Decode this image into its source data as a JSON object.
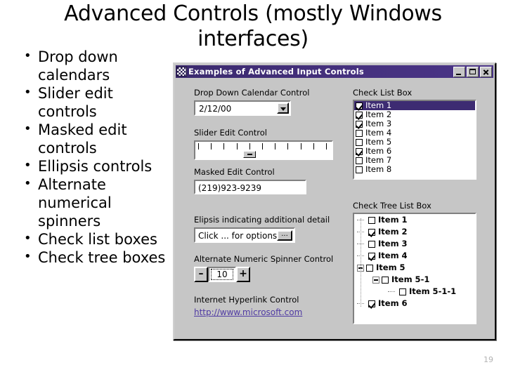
{
  "slide": {
    "title": "Advanced Controls (mostly Windows interfaces)",
    "page_number": "19",
    "bullets": [
      "Drop down calendars",
      "Slider edit controls",
      "Masked edit controls",
      "Ellipsis controls",
      "Alternate numerical spinners",
      "Check list boxes",
      "Check tree boxes"
    ]
  },
  "window": {
    "title": "Examples of Advanced Input Controls",
    "titlebar_color": "#3d2b72",
    "face_color": "#c6c6c6",
    "buttons": {
      "minimize": "minimize",
      "maximize": "maximize",
      "close": "close"
    },
    "left_column": {
      "calendar": {
        "label": "Drop Down Calendar Control",
        "value": "2/12/00"
      },
      "slider": {
        "label": "Slider Edit Control",
        "tick_count": 11,
        "thumb_position_pct": 40
      },
      "masked": {
        "label": "Masked Edit Control",
        "value": "(219)923-9239"
      },
      "ellipsis": {
        "label": "Elipsis indicating additional detail",
        "value": "Click ... for options",
        "button_label": "..."
      },
      "spinner": {
        "label": "Alternate Numeric Spinner Control",
        "value": "10",
        "decrement_label": "–",
        "increment_label": "+"
      },
      "hyperlink": {
        "label": "Internet Hyperlink Control",
        "url_text": "http://www.microsoft.com",
        "color": "#4f3aa3"
      }
    },
    "right_column": {
      "check_list": {
        "label": "Check List Box",
        "items": [
          {
            "label": "Item 1",
            "checked": true,
            "selected": true
          },
          {
            "label": "Item 2",
            "checked": true,
            "selected": false
          },
          {
            "label": "Item 3",
            "checked": true,
            "selected": false
          },
          {
            "label": "Item 4",
            "checked": false,
            "selected": false
          },
          {
            "label": "Item 5",
            "checked": false,
            "selected": false
          },
          {
            "label": "Item 6",
            "checked": true,
            "selected": false
          },
          {
            "label": "Item 7",
            "checked": false,
            "selected": false
          },
          {
            "label": "Item 8",
            "checked": false,
            "selected": false
          }
        ]
      },
      "check_tree": {
        "label": "Check Tree List Box",
        "items": [
          {
            "label": "Item 1",
            "checked": false,
            "depth": 0,
            "expander": "none"
          },
          {
            "label": "Item 2",
            "checked": true,
            "depth": 0,
            "expander": "none"
          },
          {
            "label": "Item 3",
            "checked": false,
            "depth": 0,
            "expander": "none"
          },
          {
            "label": "Item 4",
            "checked": true,
            "depth": 0,
            "expander": "none"
          },
          {
            "label": "Item 5",
            "checked": false,
            "depth": 0,
            "expander": "minus"
          },
          {
            "label": "Item 5-1",
            "checked": false,
            "depth": 1,
            "expander": "minus"
          },
          {
            "label": "Item 5-1-1",
            "checked": false,
            "depth": 2,
            "expander": "none"
          },
          {
            "label": "Item 6",
            "checked": true,
            "depth": 0,
            "expander": "none"
          }
        ]
      }
    }
  }
}
